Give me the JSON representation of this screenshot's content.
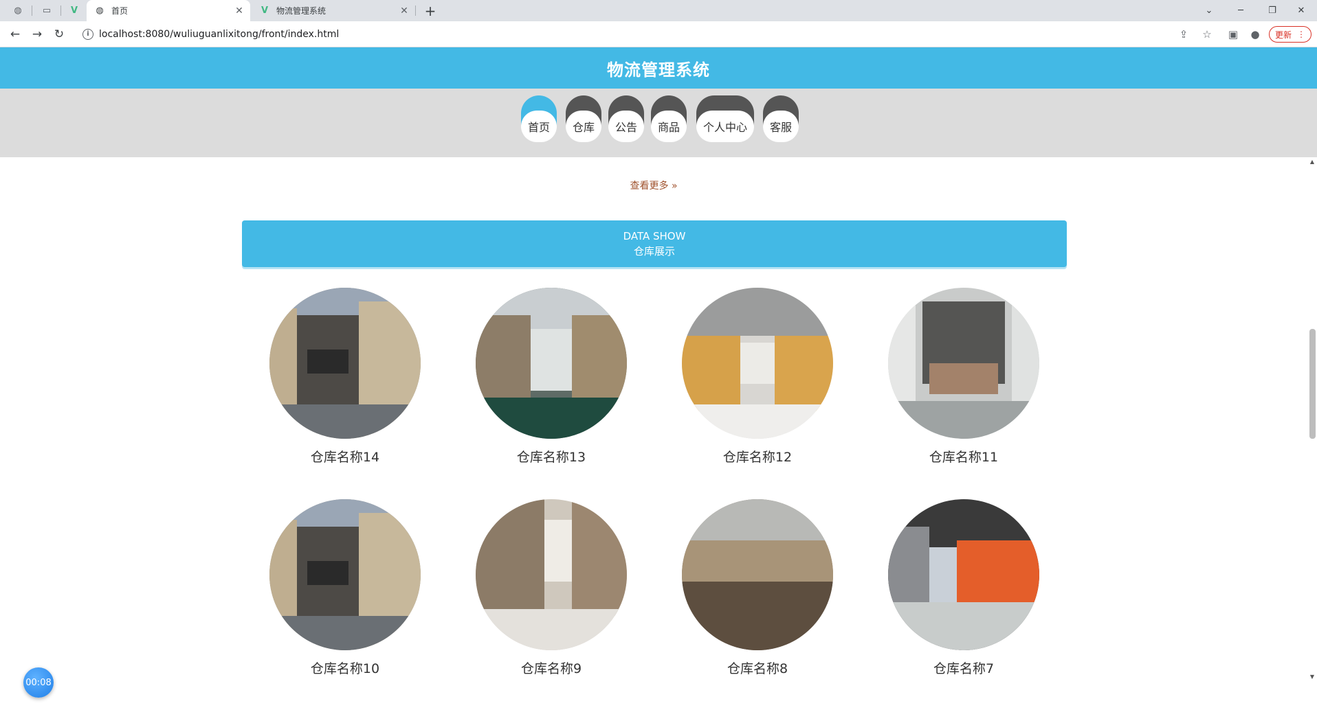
{
  "browser": {
    "tabs": [
      {
        "title": "首页",
        "active": true
      },
      {
        "title": "物流管理系统",
        "active": false
      }
    ],
    "url": "localhost:8080/wuliuguanlixitong/front/index.html",
    "update_label": "更新"
  },
  "site": {
    "title": "物流管理系统",
    "nav": [
      "首页",
      "仓库",
      "公告",
      "商品",
      "个人中心",
      "客服"
    ],
    "active_nav": 0
  },
  "more_link": "查看更多",
  "banner": {
    "en": "DATA SHOW",
    "zh": "仓库展示"
  },
  "warehouses": [
    {
      "name": "仓库名称14"
    },
    {
      "name": "仓库名称13"
    },
    {
      "name": "仓库名称12"
    },
    {
      "name": "仓库名称11"
    },
    {
      "name": "仓库名称10"
    },
    {
      "name": "仓库名称9"
    },
    {
      "name": "仓库名称8"
    },
    {
      "name": "仓库名称7"
    }
  ],
  "timer": "00:08",
  "colors": {
    "brand": "#43b9e5",
    "nav_dark": "#555555",
    "nav_bg": "#dcdcdc"
  }
}
